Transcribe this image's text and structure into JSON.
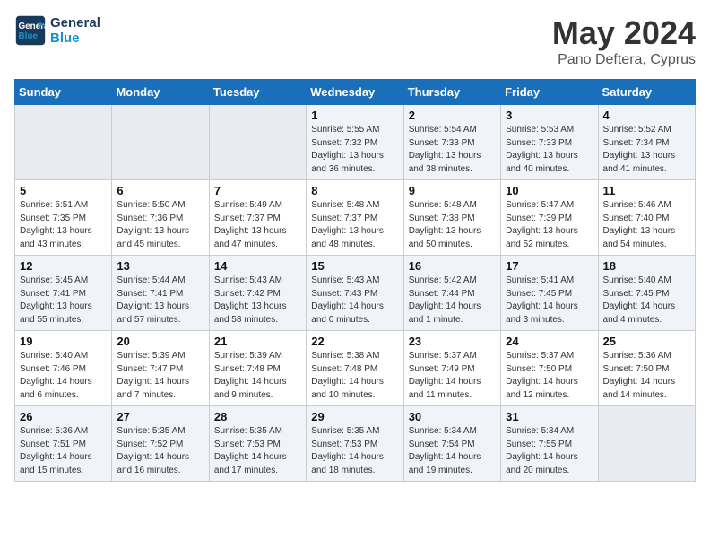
{
  "header": {
    "logo_line1": "General",
    "logo_line2": "Blue",
    "month": "May 2024",
    "location": "Pano Deftera, Cyprus"
  },
  "weekdays": [
    "Sunday",
    "Monday",
    "Tuesday",
    "Wednesday",
    "Thursday",
    "Friday",
    "Saturday"
  ],
  "weeks": [
    [
      {
        "day": "",
        "info": ""
      },
      {
        "day": "",
        "info": ""
      },
      {
        "day": "",
        "info": ""
      },
      {
        "day": "1",
        "info": "Sunrise: 5:55 AM\nSunset: 7:32 PM\nDaylight: 13 hours\nand 36 minutes."
      },
      {
        "day": "2",
        "info": "Sunrise: 5:54 AM\nSunset: 7:33 PM\nDaylight: 13 hours\nand 38 minutes."
      },
      {
        "day": "3",
        "info": "Sunrise: 5:53 AM\nSunset: 7:33 PM\nDaylight: 13 hours\nand 40 minutes."
      },
      {
        "day": "4",
        "info": "Sunrise: 5:52 AM\nSunset: 7:34 PM\nDaylight: 13 hours\nand 41 minutes."
      }
    ],
    [
      {
        "day": "5",
        "info": "Sunrise: 5:51 AM\nSunset: 7:35 PM\nDaylight: 13 hours\nand 43 minutes."
      },
      {
        "day": "6",
        "info": "Sunrise: 5:50 AM\nSunset: 7:36 PM\nDaylight: 13 hours\nand 45 minutes."
      },
      {
        "day": "7",
        "info": "Sunrise: 5:49 AM\nSunset: 7:37 PM\nDaylight: 13 hours\nand 47 minutes."
      },
      {
        "day": "8",
        "info": "Sunrise: 5:48 AM\nSunset: 7:37 PM\nDaylight: 13 hours\nand 48 minutes."
      },
      {
        "day": "9",
        "info": "Sunrise: 5:48 AM\nSunset: 7:38 PM\nDaylight: 13 hours\nand 50 minutes."
      },
      {
        "day": "10",
        "info": "Sunrise: 5:47 AM\nSunset: 7:39 PM\nDaylight: 13 hours\nand 52 minutes."
      },
      {
        "day": "11",
        "info": "Sunrise: 5:46 AM\nSunset: 7:40 PM\nDaylight: 13 hours\nand 54 minutes."
      }
    ],
    [
      {
        "day": "12",
        "info": "Sunrise: 5:45 AM\nSunset: 7:41 PM\nDaylight: 13 hours\nand 55 minutes."
      },
      {
        "day": "13",
        "info": "Sunrise: 5:44 AM\nSunset: 7:41 PM\nDaylight: 13 hours\nand 57 minutes."
      },
      {
        "day": "14",
        "info": "Sunrise: 5:43 AM\nSunset: 7:42 PM\nDaylight: 13 hours\nand 58 minutes."
      },
      {
        "day": "15",
        "info": "Sunrise: 5:43 AM\nSunset: 7:43 PM\nDaylight: 14 hours\nand 0 minutes."
      },
      {
        "day": "16",
        "info": "Sunrise: 5:42 AM\nSunset: 7:44 PM\nDaylight: 14 hours\nand 1 minute."
      },
      {
        "day": "17",
        "info": "Sunrise: 5:41 AM\nSunset: 7:45 PM\nDaylight: 14 hours\nand 3 minutes."
      },
      {
        "day": "18",
        "info": "Sunrise: 5:40 AM\nSunset: 7:45 PM\nDaylight: 14 hours\nand 4 minutes."
      }
    ],
    [
      {
        "day": "19",
        "info": "Sunrise: 5:40 AM\nSunset: 7:46 PM\nDaylight: 14 hours\nand 6 minutes."
      },
      {
        "day": "20",
        "info": "Sunrise: 5:39 AM\nSunset: 7:47 PM\nDaylight: 14 hours\nand 7 minutes."
      },
      {
        "day": "21",
        "info": "Sunrise: 5:39 AM\nSunset: 7:48 PM\nDaylight: 14 hours\nand 9 minutes."
      },
      {
        "day": "22",
        "info": "Sunrise: 5:38 AM\nSunset: 7:48 PM\nDaylight: 14 hours\nand 10 minutes."
      },
      {
        "day": "23",
        "info": "Sunrise: 5:37 AM\nSunset: 7:49 PM\nDaylight: 14 hours\nand 11 minutes."
      },
      {
        "day": "24",
        "info": "Sunrise: 5:37 AM\nSunset: 7:50 PM\nDaylight: 14 hours\nand 12 minutes."
      },
      {
        "day": "25",
        "info": "Sunrise: 5:36 AM\nSunset: 7:50 PM\nDaylight: 14 hours\nand 14 minutes."
      }
    ],
    [
      {
        "day": "26",
        "info": "Sunrise: 5:36 AM\nSunset: 7:51 PM\nDaylight: 14 hours\nand 15 minutes."
      },
      {
        "day": "27",
        "info": "Sunrise: 5:35 AM\nSunset: 7:52 PM\nDaylight: 14 hours\nand 16 minutes."
      },
      {
        "day": "28",
        "info": "Sunrise: 5:35 AM\nSunset: 7:53 PM\nDaylight: 14 hours\nand 17 minutes."
      },
      {
        "day": "29",
        "info": "Sunrise: 5:35 AM\nSunset: 7:53 PM\nDaylight: 14 hours\nand 18 minutes."
      },
      {
        "day": "30",
        "info": "Sunrise: 5:34 AM\nSunset: 7:54 PM\nDaylight: 14 hours\nand 19 minutes."
      },
      {
        "day": "31",
        "info": "Sunrise: 5:34 AM\nSunset: 7:55 PM\nDaylight: 14 hours\nand 20 minutes."
      },
      {
        "day": "",
        "info": ""
      }
    ]
  ]
}
